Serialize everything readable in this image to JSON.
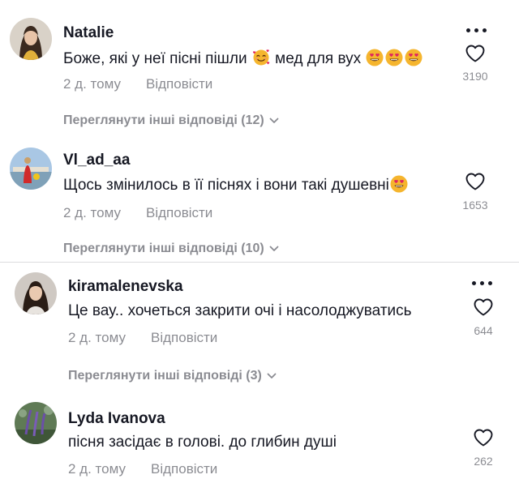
{
  "comments": [
    {
      "username": "Natalie",
      "text": "Боже, які у неї пісні пішли",
      "text_after": "мед для вух",
      "date": "2 д. тому",
      "reply_label": "Відповісти",
      "likes": "3190",
      "view_replies": "Переглянути інші відповіді (12)",
      "emoji": [
        "smiling-face-with-hearts",
        "heart-eyes",
        "heart-eyes",
        "heart-eyes"
      ],
      "has_more_menu": true
    },
    {
      "username": "Vl_ad_aa",
      "text": "Щось змінилось в її піснях і вони такі душевні",
      "date": "2 д. тому",
      "reply_label": "Відповісти",
      "likes": "1653",
      "view_replies": "Переглянути інші відповіді (10)",
      "emoji": [
        "heart-eyes"
      ],
      "has_more_menu": false
    },
    {
      "username": "kiramalenevska",
      "text": "Це вау.. хочеться закрити очі і насолоджуватись",
      "date": "2 д. тому",
      "reply_label": "Відповісти",
      "likes": "644",
      "view_replies": "Переглянути інші відповіді (3)",
      "has_more_menu": true
    },
    {
      "username": "Lyda Ivanova",
      "text": "пісня засідає в голові. до глибин душі",
      "date": "2 д. тому",
      "reply_label": "Відповісти",
      "likes": "262",
      "has_more_menu": false
    }
  ],
  "colors": {
    "text": "#161823",
    "muted": "rgba(22,24,35,0.5)",
    "divider": "rgba(22,24,35,0.15)"
  }
}
